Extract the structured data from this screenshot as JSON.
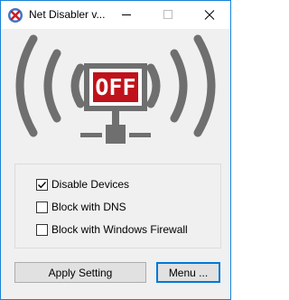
{
  "window": {
    "title": "Net Disabler v...",
    "accent_color": "#1883d7"
  },
  "illustration": {
    "status_text": "OFF",
    "status_color": "#c0121a",
    "wave_color": "#6f6f6f"
  },
  "options": [
    {
      "label": "Disable Devices",
      "checked": true
    },
    {
      "label": "Block with DNS",
      "checked": false
    },
    {
      "label": "Block with Windows Firewall",
      "checked": false
    }
  ],
  "buttons": {
    "apply_label": "Apply Setting",
    "menu_label": "Menu ..."
  },
  "icons": {
    "app": "net-disabler-icon",
    "minimize": "minimize-icon",
    "maximize": "maximize-icon",
    "close": "close-icon",
    "checkmark": "checkmark-icon"
  }
}
